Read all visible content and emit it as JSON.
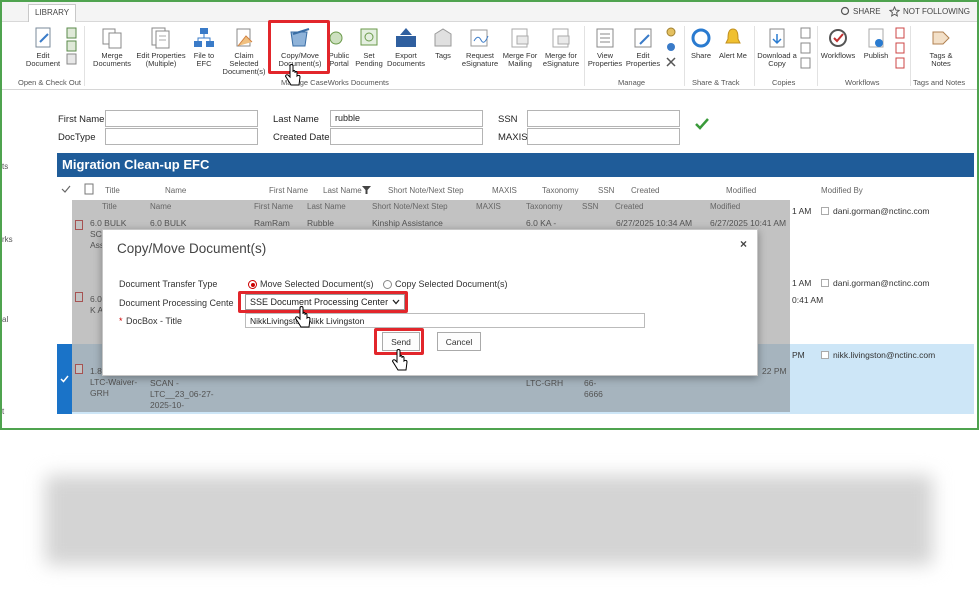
{
  "ribbon": {
    "tab_library": "LIBRARY",
    "share": "SHARE",
    "not_following": "NOT FOLLOWING",
    "buttons": [
      {
        "label": "Edit Document"
      },
      {
        "label": "Merge Documents"
      },
      {
        "label": "Edit Properties (Multiple)"
      },
      {
        "label": "File to EFC"
      },
      {
        "label": "Claim Selected Document(s)"
      },
      {
        "label": "Copy/Move Document(s)"
      },
      {
        "label": "Public Portal"
      },
      {
        "label": "Set Pending"
      },
      {
        "label": "Export Documents"
      },
      {
        "label": "Tags"
      },
      {
        "label": "Request eSignature"
      },
      {
        "label": "Merge For Mailing"
      },
      {
        "label": "Merge for eSignature"
      },
      {
        "label": "View Properties"
      },
      {
        "label": "Edit Properties"
      },
      {
        "label": "Share"
      },
      {
        "label": "Alert Me"
      },
      {
        "label": "Download a Copy"
      },
      {
        "label": "Workflows"
      },
      {
        "label": "Publish"
      },
      {
        "label": "Tags & Notes"
      }
    ],
    "groups": [
      {
        "label": "Open & Check Out"
      },
      {
        "label": "Manage CaseWorks Documents"
      },
      {
        "label": "Manage"
      },
      {
        "label": "Share & Track"
      },
      {
        "label": "Copies"
      },
      {
        "label": "Workflows"
      },
      {
        "label": "Tags and Notes"
      }
    ]
  },
  "leftnav": [
    "ts",
    "rks",
    "al",
    "t"
  ],
  "search": {
    "first_name_label": "First Name",
    "first_name_value": "",
    "last_name_label": "Last Name",
    "last_name_value": "rubble",
    "ssn_label": "SSN",
    "ssn_value": "",
    "doctype_label": "DocType",
    "doctype_value": "",
    "created_date_label": "Created Date",
    "created_date_value": "",
    "maxis_label": "MAXIS",
    "maxis_value": ""
  },
  "list": {
    "title": "Migration Clean-up EFC",
    "headers": [
      "Title",
      "Name",
      "First Name",
      "Last Name",
      "Short Note/Next Step",
      "MAXIS",
      "Taxonomy",
      "SSN",
      "Created",
      "Modified",
      "Modified By"
    ],
    "rows": [
      {
        "title": "6.0 BULK SCAN - K Ass",
        "name": "6.0 BULK",
        "first": "RamRam",
        "last": "Rubble",
        "note": "Kinship Assistance",
        "taxonomy": "6.0 KA -",
        "created": "6/27/2025 10:34 AM",
        "modified": "6/27/2025 10:41 AM",
        "modified_right": "1 AM",
        "modified_by": "dani.gorman@nctinc.com"
      },
      {
        "title": "6.0 SCA - K Ass",
        "modified_right": "0:41 AM",
        "modified_by": "dani.gorman@nctinc.com"
      },
      {
        "title": "1.8 SCAN - LTC-Waiver-GRH",
        "name": "SCAN - LTC__23_06-27-2025-10-",
        "taxonomy": "LTC-GRH",
        "ssn": "66-6666",
        "modified_right": "PM",
        "modified_right2": "22 PM",
        "modified_by": "nikk.livingston@nctinc.com"
      }
    ]
  },
  "dialog": {
    "title": "Copy/Move Document(s)",
    "close": "×",
    "transfer_type_label": "Document Transfer Type",
    "move_option": "Move Selected Document(s)",
    "copy_option": "Copy Selected Document(s)",
    "processing_center_label": "Document Processing Cente",
    "processing_center_value": "SSE Document Processing Center",
    "docbox_label": "DocBox - Title",
    "docbox_required": "*",
    "docbox_value": "NikkLivingston Nikk Livingston",
    "send": "Send",
    "cancel": "Cancel"
  },
  "colors": {
    "banner": "#1f5c99",
    "highlight": "#e2262b",
    "frame": "#4fa34f"
  }
}
